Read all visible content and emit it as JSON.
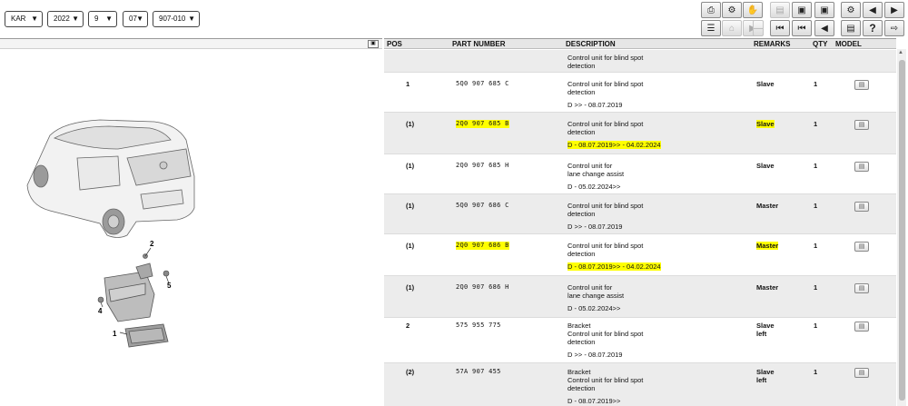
{
  "filters": {
    "brand": "KAR",
    "year": "2022",
    "month": "9",
    "day": "07",
    "group": "907-010"
  },
  "table": {
    "headers": {
      "pos": "POS",
      "part_number": "PART NUMBER",
      "description": "DESCRIPTION",
      "remarks": "REMARKS",
      "qty": "QTY",
      "model": "MODEL"
    },
    "rows": [
      {
        "pos": "",
        "part_number": "",
        "desc1": "Control unit for blind spot",
        "desc2": "detection",
        "date": "",
        "remarks": "",
        "remarks2": "",
        "qty": ""
      },
      {
        "pos": "1",
        "part_number": "5Q0 907 685 C",
        "desc1": "Control unit for blind spot",
        "desc2": "detection",
        "date": "D      >> - 08.07.2019",
        "remarks": "Slave",
        "remarks2": "",
        "qty": "1"
      },
      {
        "pos": "(1)",
        "part_number": "2Q0 907 685 B",
        "desc1": "Control unit for blind spot",
        "desc2": "detection",
        "date": "D - 08.07.2019>> - 04.02.2024",
        "remarks": "Slave",
        "remarks2": "",
        "qty": "1"
      },
      {
        "pos": "(1)",
        "part_number": "2Q0 907 685 H",
        "desc1": "Control unit for",
        "desc2": "lane change assist",
        "date": "D - 05.02.2024>>",
        "remarks": "Slave",
        "remarks2": "",
        "qty": "1"
      },
      {
        "pos": "(1)",
        "part_number": "5Q0 907 686 C",
        "desc1": "Control unit for blind spot",
        "desc2": "detection",
        "date": "D      >> - 08.07.2019",
        "remarks": "Master",
        "remarks2": "",
        "qty": "1"
      },
      {
        "pos": "(1)",
        "part_number": "2Q0 907 686 B",
        "desc1": "Control unit for blind spot",
        "desc2": "detection",
        "date": "D - 08.07.2019>> - 04.02.2024",
        "remarks": "Master",
        "remarks2": "",
        "qty": "1"
      },
      {
        "pos": "(1)",
        "part_number": "2Q0 907 686 H",
        "desc1": "Control unit for",
        "desc2": "lane change assist",
        "date": "D - 05.02.2024>>",
        "remarks": "Master",
        "remarks2": "",
        "qty": "1"
      },
      {
        "pos": "2",
        "part_number": "575 955 775",
        "desc0": "Bracket",
        "desc1": "Control unit for blind spot",
        "desc2": "detection",
        "date": "D      >> - 08.07.2019",
        "remarks": "Slave",
        "remarks2": "left",
        "qty": "1"
      },
      {
        "pos": "(2)",
        "part_number": "57A 907 455",
        "desc0": "Bracket",
        "desc1": "Control unit for blind spot",
        "desc2": "detection",
        "date": "D - 08.07.2019>>",
        "remarks": "Slave",
        "remarks2": "left",
        "qty": "1"
      }
    ]
  },
  "diagram": {
    "callouts": [
      "1",
      "2",
      "4",
      "5"
    ]
  },
  "toolbar": {
    "icons": [
      "print-icon",
      "search-parts-icon",
      "handshake-icon",
      "disabled-sheet-icon",
      "cart-sheet-icon",
      "cart-sheet-2-icon",
      "settings-icon",
      "prev-page-icon",
      "next-page-icon",
      "list-icon",
      "home-icon",
      "play-icon",
      "minus-icon",
      "first-icon",
      "back-icon",
      "prev-icon",
      "menu-icon",
      "help-icon",
      "export-icon"
    ],
    "help_label": "?"
  },
  "colors": {
    "highlight": "#ffff00",
    "alt_row": "#ececec"
  }
}
